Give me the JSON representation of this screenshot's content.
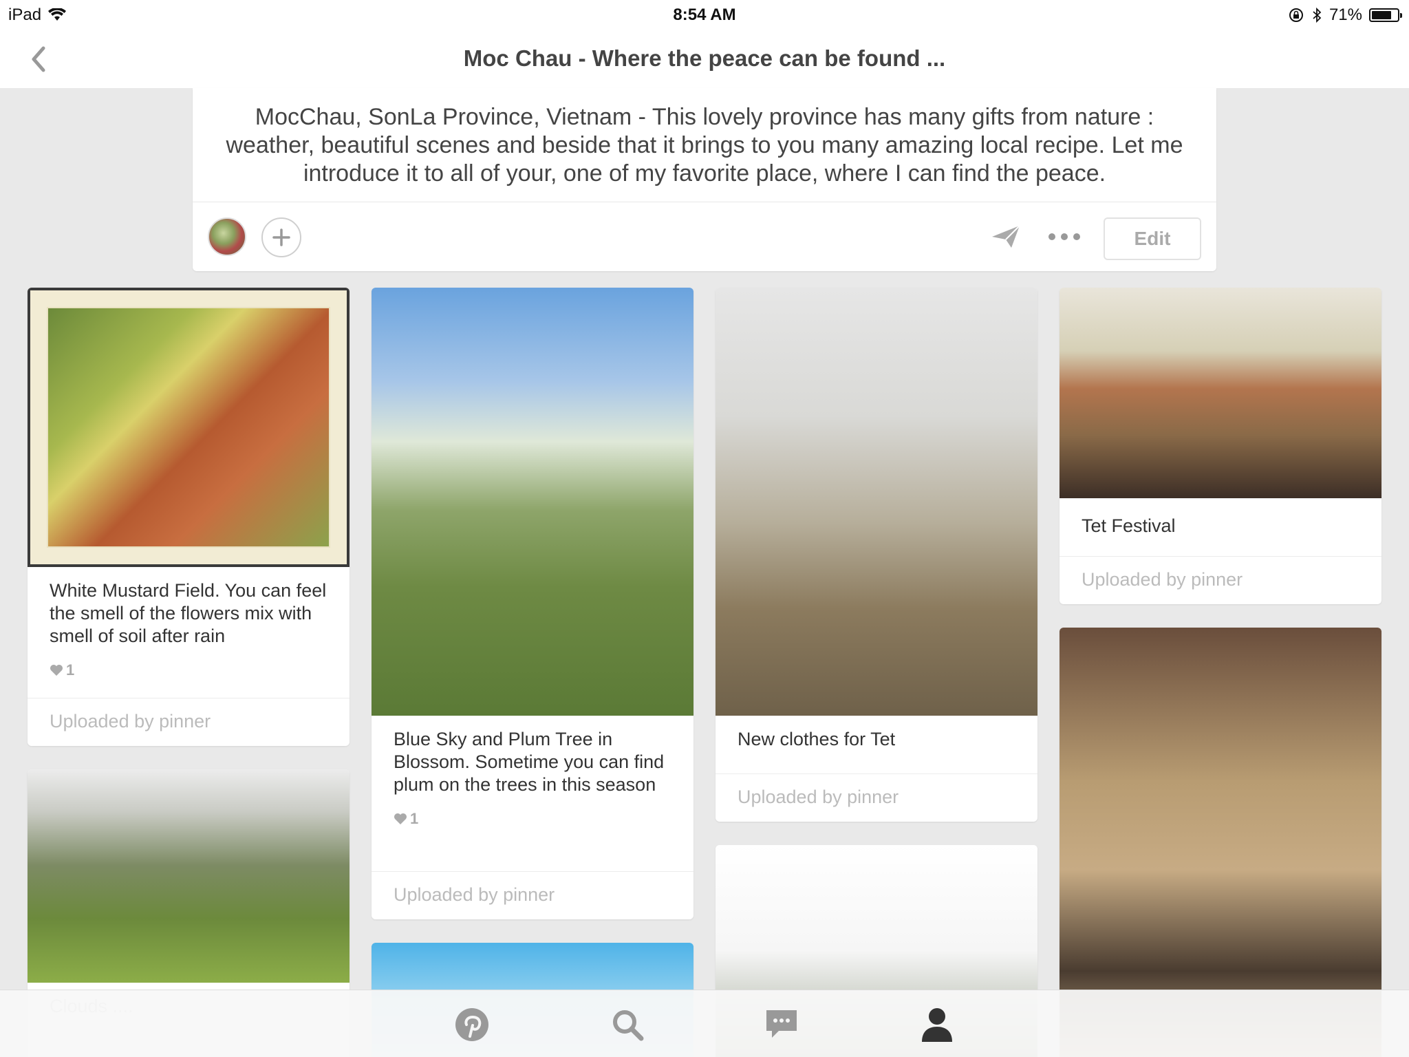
{
  "status": {
    "device": "iPad",
    "time": "8:54 AM",
    "battery": "71%",
    "battery_level": 0.71
  },
  "nav": {
    "title": "Moc Chau - Where the peace can be found ..."
  },
  "board": {
    "description": "MocChau, SonLa Province, Vietnam - This lovely province has many gifts from nature : weather, beautiful scenes and beside that it brings to you many amazing local recipe. Let me introduce it to all of your, one of my favorite place, where I can find the peace.",
    "edit_label": "Edit"
  },
  "pins": [
    {
      "caption": "White Mustard Field. You can feel the smell of the flowers mix with smell of soil after rain",
      "likes": "1",
      "uploaded": "Uploaded by pinner"
    },
    {
      "caption": "Blue Sky and Plum Tree in Blossom. Sometime you can find plum on the trees in this season",
      "likes": "1",
      "uploaded": "Uploaded by pinner"
    },
    {
      "caption": "New clothes for Tet",
      "uploaded": "Uploaded by pinner"
    },
    {
      "caption": "Tet Festival",
      "uploaded": "Uploaded by pinner"
    },
    {
      "caption": "Clouds ...."
    }
  ],
  "tabs": [
    {
      "icon": "pinterest-icon"
    },
    {
      "icon": "search-icon"
    },
    {
      "icon": "messages-icon"
    },
    {
      "icon": "profile-icon"
    }
  ],
  "colors": {
    "background": "#e9e9e9",
    "card": "#ffffff",
    "muted_text": "#bbbbbb",
    "icon_gray": "#999999"
  }
}
